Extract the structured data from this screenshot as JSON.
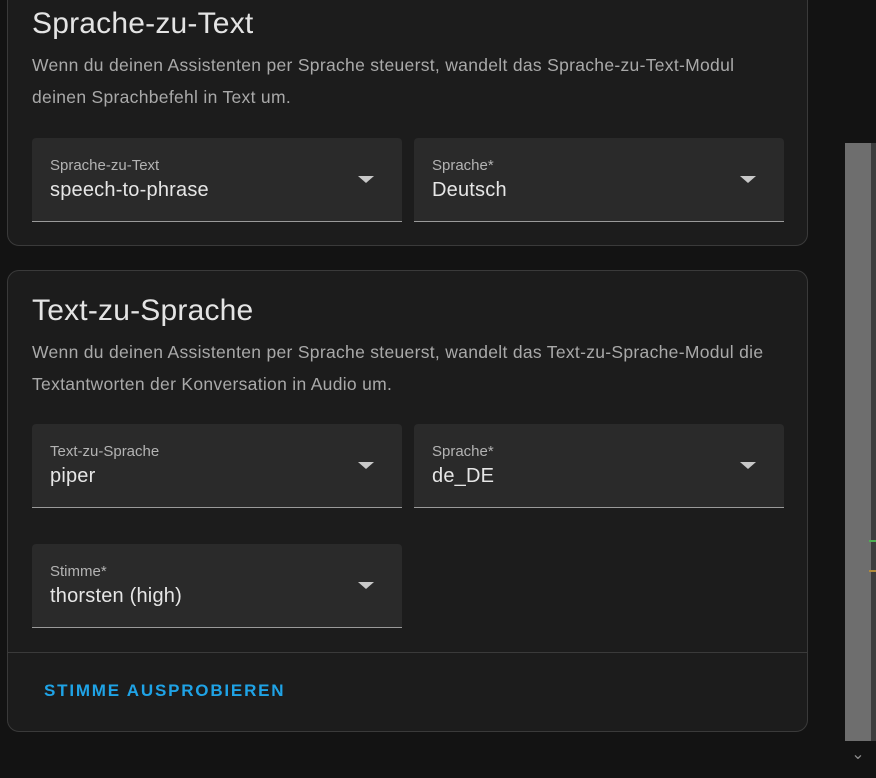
{
  "stt_section": {
    "title": "Sprache-zu-Text",
    "description": "Wenn du deinen Assistenten per Sprache steuerst, wandelt das Sprache-zu-Text-Modul deinen Sprachbefehl in Text um.",
    "engine_select": {
      "label": "Sprache-zu-Text",
      "value": "speech-to-phrase"
    },
    "language_select": {
      "label": "Sprache*",
      "value": "Deutsch"
    }
  },
  "tts_section": {
    "title": "Text-zu-Sprache",
    "description": "Wenn du deinen Assistenten per Sprache steuerst, wandelt das Text-zu-Sprache-Modul die Textantworten der Konversation in Audio um.",
    "engine_select": {
      "label": "Text-zu-Sprache",
      "value": "piper"
    },
    "language_select": {
      "label": "Sprache*",
      "value": "de_DE"
    },
    "voice_select": {
      "label": "Stimme*",
      "value": "thorsten (high)"
    },
    "try_voice_button": "STIMME AUSPROBIEREN"
  },
  "icons": {
    "dropdown": "chevron-down-icon",
    "scroll_down": "chevron-down-icon"
  },
  "colors": {
    "background": "#131313",
    "card": "#1c1c1c",
    "field": "#2a2a2a",
    "accent": "#1fa3e6",
    "text_primary": "#e4e4e4",
    "text_secondary": "#a9a9a9"
  }
}
